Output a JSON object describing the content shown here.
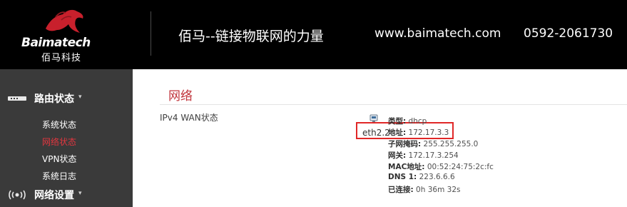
{
  "header": {
    "logo_en": "Baimatech",
    "logo_cn": "佰马科技",
    "slogan": "佰马--链接物联网的力量",
    "website": "www.baimatech.com",
    "phone": "0592-2061730"
  },
  "sidebar": {
    "sections": [
      {
        "label": "路由状态",
        "icon": "router-icon",
        "caret": "▾"
      },
      {
        "label": "网络设置",
        "icon": "wifi-broadcast-icon",
        "caret": "▾"
      }
    ],
    "items": [
      {
        "label": "系统状态",
        "active": false
      },
      {
        "label": "网络状态",
        "active": true
      },
      {
        "label": "VPN状态",
        "active": false
      },
      {
        "label": "系统日志",
        "active": false
      }
    ]
  },
  "main": {
    "title": "网络",
    "row_label": "IPv4 WAN状态",
    "interface": {
      "name": "eth2.2",
      "icon": "ethernet-port-icon"
    },
    "details": [
      {
        "key": "类型:",
        "value": "dhcp"
      },
      {
        "key": "地址:",
        "value": "172.17.3.3"
      },
      {
        "key": "子网掩码:",
        "value": "255.255.255.0"
      },
      {
        "key": "网关:",
        "value": "172.17.3.254"
      },
      {
        "key": "MAC地址:",
        "value": "00:52:24:75:2c:fc"
      },
      {
        "key": "DNS 1:",
        "value": "223.6.6.6"
      },
      {
        "key": "已连接:",
        "value": "0h 36m 32s"
      }
    ]
  },
  "colors": {
    "header_bg": "#000000",
    "sidebar_bg": "#3a3a3a",
    "accent": "#c0333a",
    "highlight_border": "#e02828"
  }
}
